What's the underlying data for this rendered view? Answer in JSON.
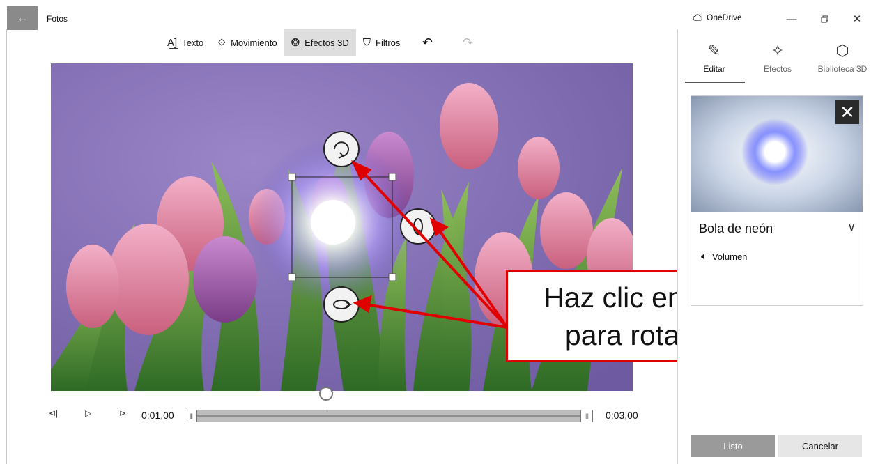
{
  "window": {
    "app_title": "Fotos",
    "onedrive_label": "OneDrive"
  },
  "toolbar": {
    "items": [
      {
        "label": "Texto",
        "icon": "text-icon"
      },
      {
        "label": "Movimiento",
        "icon": "motion-icon"
      },
      {
        "label": "Efectos 3D",
        "icon": "3d-effects-icon",
        "active": true
      },
      {
        "label": "Filtros",
        "icon": "filters-icon"
      }
    ],
    "undo_icon": "undo-icon",
    "redo_icon": "redo-icon"
  },
  "side_panel": {
    "tabs": [
      {
        "label": "Editar",
        "icon": "pencil-icon",
        "active": true
      },
      {
        "label": "Efectos",
        "icon": "sparkles-icon"
      },
      {
        "label": "Biblioteca 3D",
        "icon": "cube-icon"
      }
    ],
    "effect": {
      "name": "Bola de neón",
      "volume_label": "Volumen"
    },
    "done_label": "Listo",
    "cancel_label": "Cancelar"
  },
  "playback": {
    "current_time": "0:01,00",
    "end_time": "0:03,00"
  },
  "annotation": {
    "line1": "Haz clic en las flechas",
    "line2": "para rotar el efecto",
    "color": "#e00000"
  }
}
